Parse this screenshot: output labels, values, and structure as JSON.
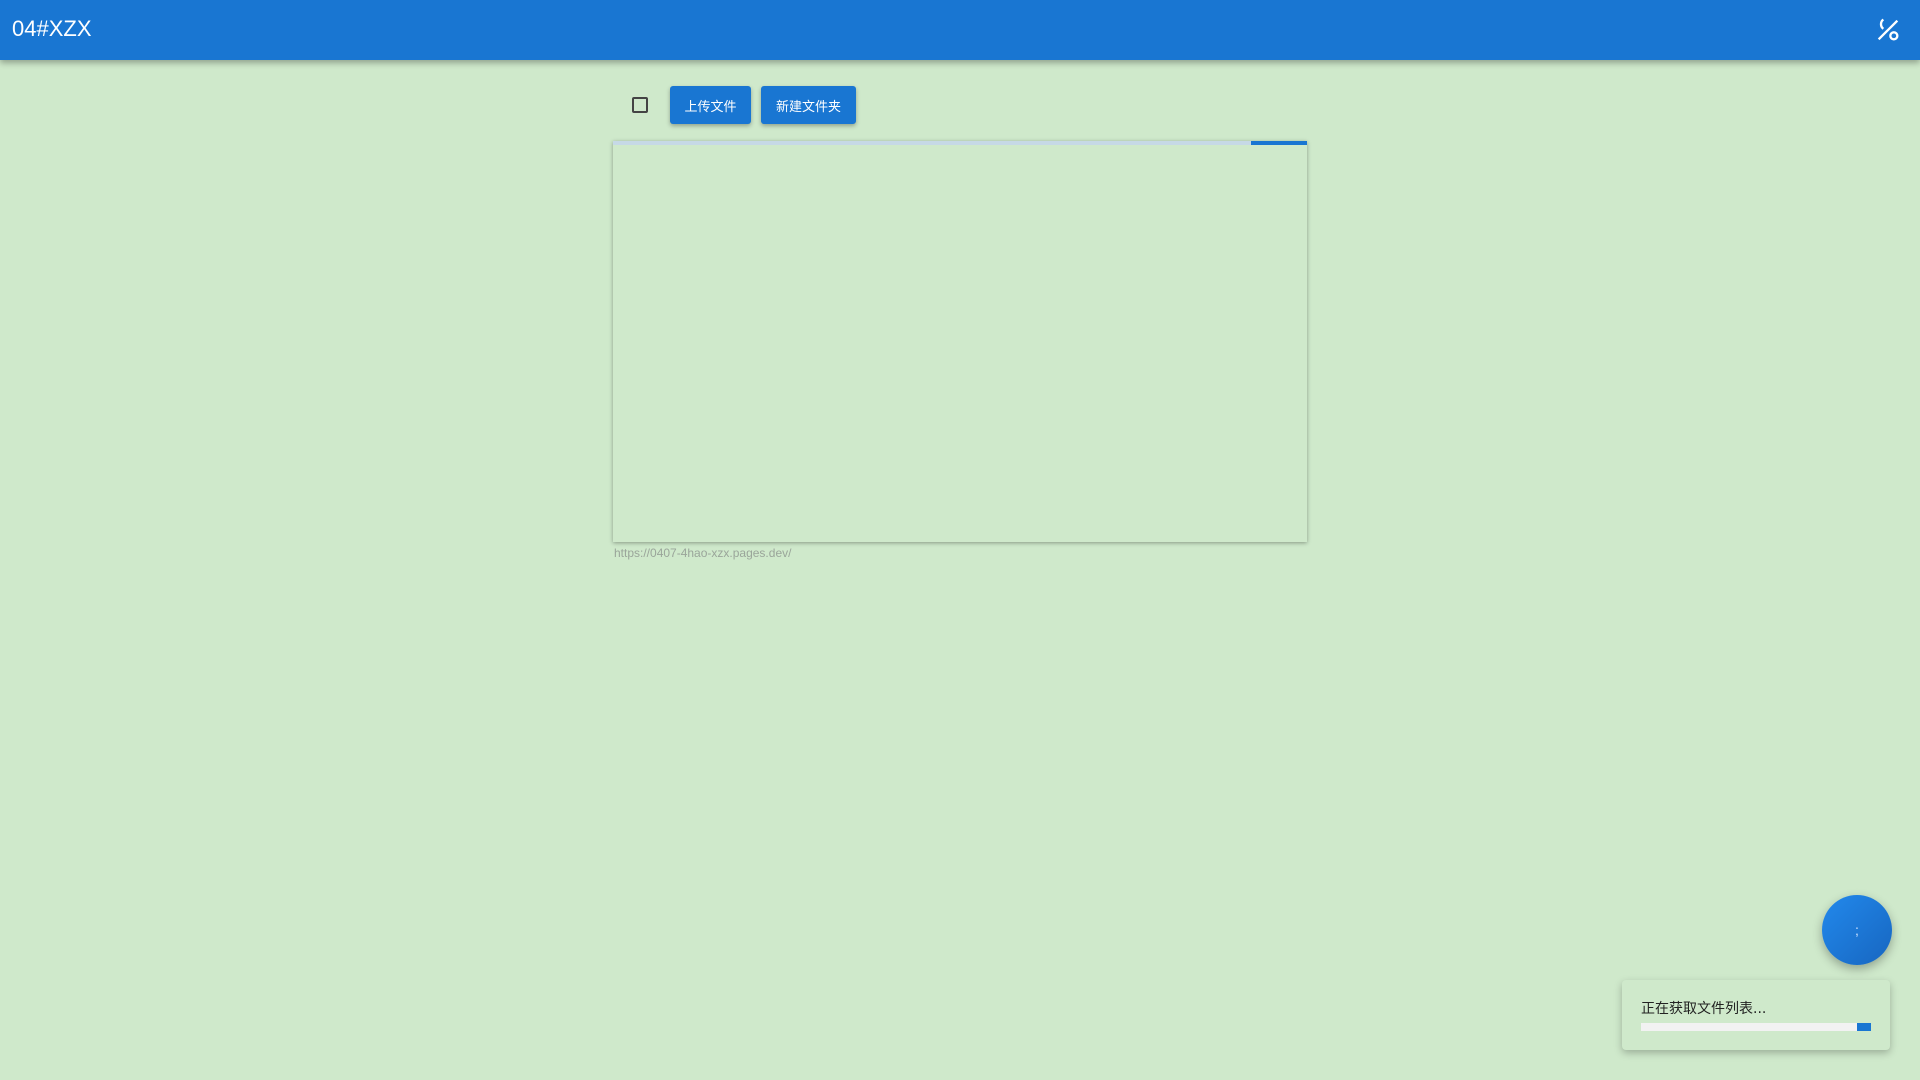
{
  "header": {
    "title": "04#XZX",
    "theme_icon": "theme-toggle-icon"
  },
  "toolbar": {
    "upload_label": "上传文件",
    "new_folder_label": "新建文件夹"
  },
  "panel": {
    "loading_progress_percent": 8
  },
  "footer": {
    "url": "https://0407-4hao-xzx.pages.dev/"
  },
  "fab": {
    "label": ";"
  },
  "toast": {
    "message": "正在获取文件列表...",
    "progress_percent": 6
  },
  "colors": {
    "primary": "#1976d2",
    "background": "#cfe9cb"
  }
}
